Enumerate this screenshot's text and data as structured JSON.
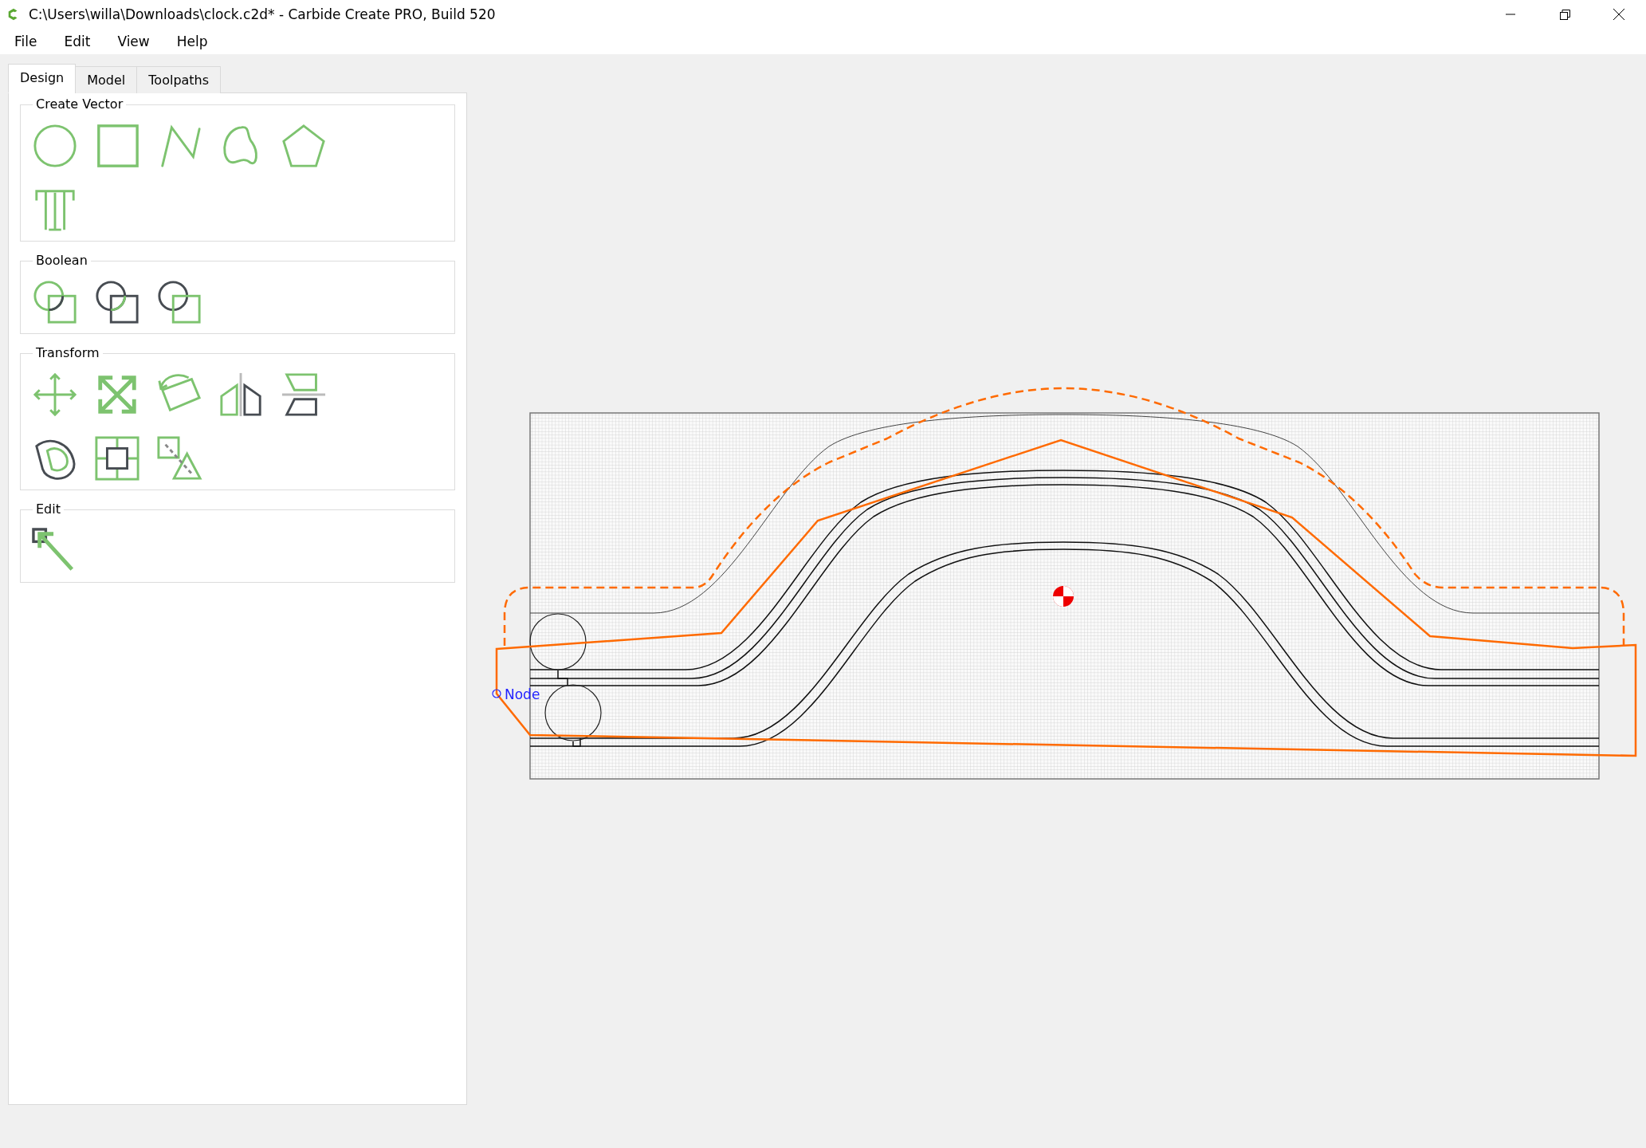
{
  "window": {
    "title": "C:\\Users\\willa\\Downloads\\clock.c2d* - Carbide Create PRO, Build 520"
  },
  "menu": [
    "File",
    "Edit",
    "View",
    "Help"
  ],
  "tabs": [
    {
      "label": "Design",
      "selected": true
    },
    {
      "label": "Model",
      "selected": false
    },
    {
      "label": "Toolpaths",
      "selected": false
    }
  ],
  "groups": [
    {
      "title": "Create Vector",
      "tools": [
        {
          "kind": "circle"
        },
        {
          "kind": "rectangle"
        },
        {
          "kind": "polyline"
        },
        {
          "kind": "curve"
        },
        {
          "kind": "polygon"
        },
        {
          "kind": "text"
        }
      ]
    },
    {
      "title": "Boolean",
      "tools": [
        {
          "kind": "union"
        },
        {
          "kind": "subtract"
        },
        {
          "kind": "intersect"
        }
      ]
    },
    {
      "title": "Transform",
      "tools": [
        {
          "kind": "move"
        },
        {
          "kind": "scale"
        },
        {
          "kind": "rotate"
        },
        {
          "kind": "mirror-h"
        },
        {
          "kind": "mirror-v"
        },
        {
          "kind": "offset"
        },
        {
          "kind": "align"
        },
        {
          "kind": "jointo"
        }
      ]
    },
    {
      "title": "Edit",
      "tools": [
        {
          "kind": "nodeedit"
        }
      ]
    }
  ],
  "canvas": {
    "node_label": "Node"
  }
}
